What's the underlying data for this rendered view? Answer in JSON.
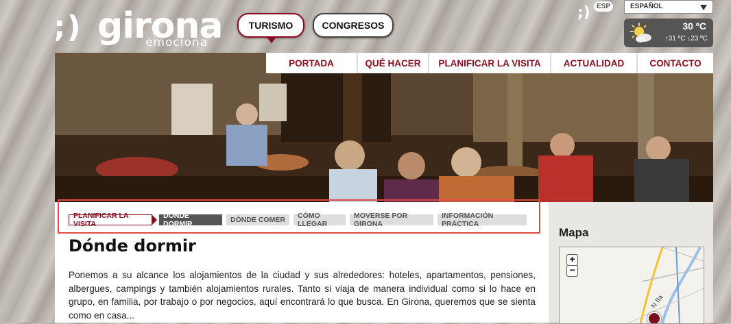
{
  "logo": {
    "smile": ";)",
    "name": "girona",
    "tagline": "emociona"
  },
  "top_tabs": [
    {
      "label": "TURISMO"
    },
    {
      "label": "CONGRESOS"
    }
  ],
  "header": {
    "smile": ";)",
    "lang_badge": "ESP",
    "language": "ESPAÑOL",
    "weather": {
      "temperature": "30 ºC",
      "range": "↑31 ºC ↓23 ºC",
      "icon": "partly-cloudy-icon"
    }
  },
  "nav": [
    {
      "label": "PORTADA"
    },
    {
      "label": "QUÉ HACER"
    },
    {
      "label": "PLANIFICAR LA VISITA"
    },
    {
      "label": "ACTUALIDAD"
    },
    {
      "label": "CONTACTO"
    }
  ],
  "breadcrumb": {
    "home": "PLANIFICAR LA VISITA",
    "items": [
      {
        "label": "DÓNDE DORMIR"
      },
      {
        "label": "DÓNDE COMER"
      },
      {
        "label": "CÓMO LLEGAR"
      },
      {
        "label": "MOVERSE POR GIRONA"
      },
      {
        "label": "INFORMACIÓN PRÁCTICA"
      }
    ]
  },
  "main": {
    "title": "Dónde dormir",
    "paragraph": "Ponemos a su alcance los alojamientos de la ciudad y sus alrededores: hoteles, apartamentos, pensiones, albergues, campings y también alojamientos rurales. Tanto si viaja de manera individual como si lo hace en grupo, en familia, por trabajo o por negocios, aquí encontrará lo que busca. En Girona, queremos que se sienta como en casa..."
  },
  "sidebar": {
    "map_title": "Mapa",
    "zoom_in": "+",
    "zoom_out": "−",
    "road_label": "N IIa"
  },
  "colors": {
    "accent": "#8b0b1d",
    "active_crumb": "#555555",
    "crumb_bg": "#dddddd"
  }
}
